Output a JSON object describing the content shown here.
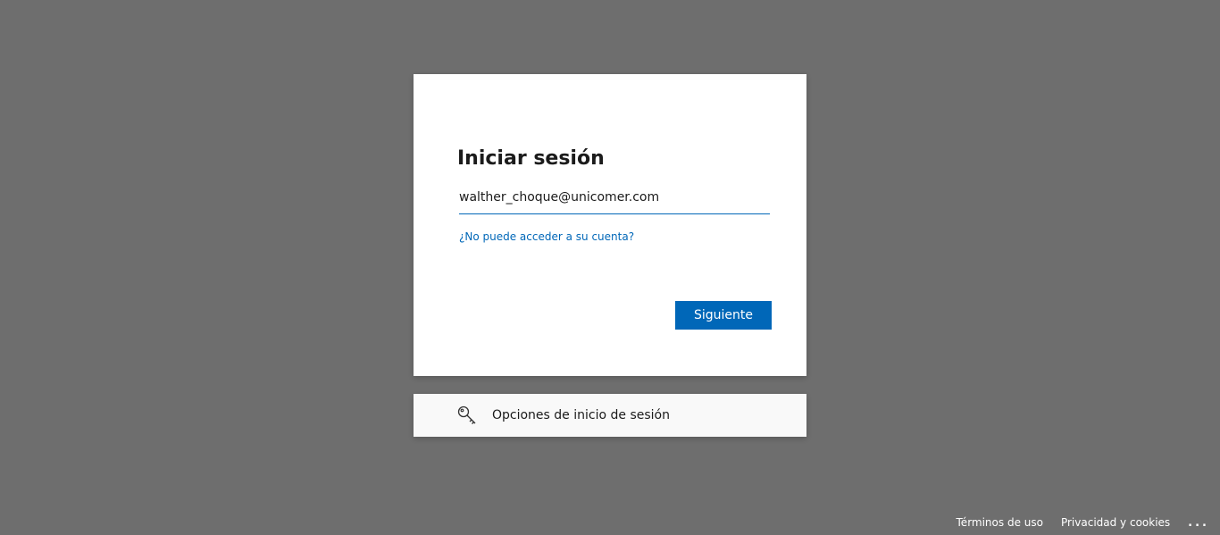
{
  "login": {
    "title": "Iniciar sesión",
    "email_value": "walther_choque@unicomer.com",
    "help_link": "¿No puede acceder a su cuenta?",
    "next_button": "Siguiente"
  },
  "options": {
    "icon": "key-icon",
    "label": "Opciones de inicio de sesión"
  },
  "footer": {
    "terms": "Términos de uso",
    "privacy": "Privacidad y cookies",
    "more": "..."
  },
  "colors": {
    "background": "#6e6e6e",
    "accent": "#0067b8",
    "card": "#ffffff",
    "options_card": "#f9f9f9"
  }
}
